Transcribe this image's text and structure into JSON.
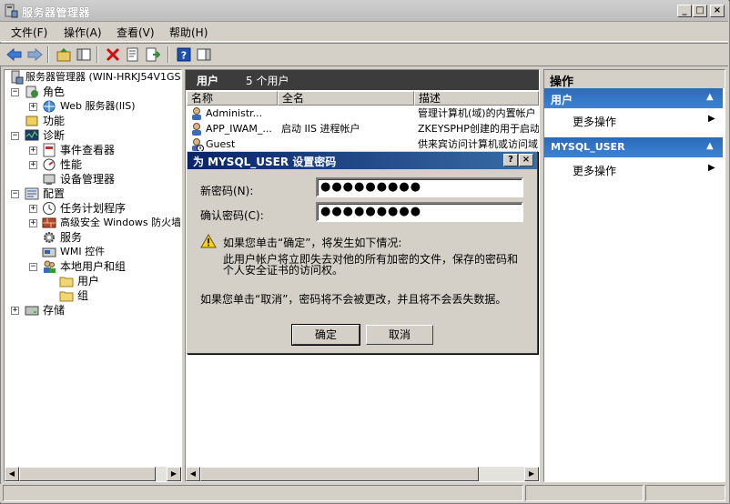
{
  "window": {
    "title": "服务器管理器"
  },
  "menu": [
    {
      "label": "文件(F)"
    },
    {
      "label": "操作(A)"
    },
    {
      "label": "查看(V)"
    },
    {
      "label": "帮助(H)"
    }
  ],
  "tree": {
    "items": [
      {
        "label": "服务器管理器 (WIN-HRKJ54V1GS"
      },
      {
        "label": "角色"
      },
      {
        "label": "Web 服务器(IIS)"
      },
      {
        "label": "功能"
      },
      {
        "label": "诊断"
      },
      {
        "label": "事件查看器"
      },
      {
        "label": "性能"
      },
      {
        "label": "设备管理器"
      },
      {
        "label": "配置"
      },
      {
        "label": "任务计划程序"
      },
      {
        "label": "高级安全 Windows 防火墙"
      },
      {
        "label": "服务"
      },
      {
        "label": "WMI 控件"
      },
      {
        "label": "本地用户和组"
      },
      {
        "label": "用户"
      },
      {
        "label": "组"
      },
      {
        "label": "存储"
      }
    ]
  },
  "middle": {
    "header_title": "用户",
    "header_count": "5 个用户",
    "columns": [
      "名称",
      "全名",
      "描述"
    ],
    "rows": [
      {
        "name": "Administr...",
        "fullname": "",
        "desc": "管理计算机(域)的内置帐户"
      },
      {
        "name": "APP_IWAM_...",
        "fullname": "启动 IIS 进程帐户",
        "desc": "ZKEYSPHP创建的用于启动"
      },
      {
        "name": "Guest",
        "fullname": "",
        "desc": "供来宾访问计算机或访问域"
      }
    ]
  },
  "actions": {
    "title": "操作",
    "sections": [
      {
        "label": "用户",
        "item": "更多操作"
      },
      {
        "label": "MYSQL_USER",
        "item": "更多操作"
      }
    ]
  },
  "dialog": {
    "title": "为 MYSQL_USER 设置密码",
    "help": "?",
    "close": "×",
    "new_label": "新密码(N):",
    "new_value": "●●●●●●●●●",
    "confirm_label": "确认密码(C):",
    "confirm_value": "●●●●●●●●●",
    "warn_line1": "如果您单击“确定”，将发生如下情况:",
    "warn_line2": "此用户帐户将立即失去对他的所有加密的文件，保存的密码和",
    "warn_line3": "个人安全证书的访问权。",
    "cancel_note": "如果您单击“取消”，密码将不会被更改，并且将不会丢失数据。",
    "ok": "确定",
    "cancel": "取消"
  }
}
